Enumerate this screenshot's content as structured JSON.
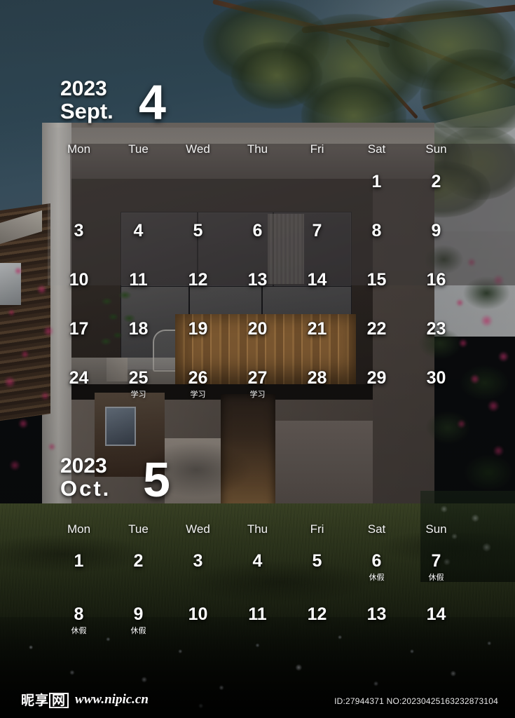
{
  "months": [
    {
      "id": "sept",
      "year": "2023",
      "name": "Sept.",
      "number": "4",
      "weekdays": [
        "Mon",
        "Tue",
        "Wed",
        "Thu",
        "Fri",
        "Sat",
        "Sun"
      ],
      "weeks": [
        [
          {
            "day": "",
            "note": ""
          },
          {
            "day": "",
            "note": ""
          },
          {
            "day": "",
            "note": ""
          },
          {
            "day": "",
            "note": ""
          },
          {
            "day": "",
            "note": ""
          },
          {
            "day": "1",
            "note": ""
          },
          {
            "day": "2",
            "note": ""
          }
        ],
        [
          {
            "day": "3",
            "note": ""
          },
          {
            "day": "4",
            "note": ""
          },
          {
            "day": "5",
            "note": ""
          },
          {
            "day": "6",
            "note": ""
          },
          {
            "day": "7",
            "note": ""
          },
          {
            "day": "8",
            "note": ""
          },
          {
            "day": "9",
            "note": ""
          }
        ],
        [
          {
            "day": "10",
            "note": ""
          },
          {
            "day": "11",
            "note": ""
          },
          {
            "day": "12",
            "note": ""
          },
          {
            "day": "13",
            "note": ""
          },
          {
            "day": "14",
            "note": ""
          },
          {
            "day": "15",
            "note": ""
          },
          {
            "day": "16",
            "note": ""
          }
        ],
        [
          {
            "day": "17",
            "note": ""
          },
          {
            "day": "18",
            "note": ""
          },
          {
            "day": "19",
            "note": ""
          },
          {
            "day": "20",
            "note": ""
          },
          {
            "day": "21",
            "note": ""
          },
          {
            "day": "22",
            "note": ""
          },
          {
            "day": "23",
            "note": ""
          }
        ],
        [
          {
            "day": "24",
            "note": ""
          },
          {
            "day": "25",
            "note": "学习"
          },
          {
            "day": "26",
            "note": "学习"
          },
          {
            "day": "27",
            "note": "学习"
          },
          {
            "day": "28",
            "note": ""
          },
          {
            "day": "29",
            "note": ""
          },
          {
            "day": "30",
            "note": ""
          }
        ]
      ]
    },
    {
      "id": "oct",
      "year": "2023",
      "name": "Oct.",
      "number": "5",
      "weekdays": [
        "Mon",
        "Tue",
        "Wed",
        "Thu",
        "Fri",
        "Sat",
        "Sun"
      ],
      "weeks": [
        [
          {
            "day": "1",
            "note": ""
          },
          {
            "day": "2",
            "note": ""
          },
          {
            "day": "3",
            "note": ""
          },
          {
            "day": "4",
            "note": ""
          },
          {
            "day": "5",
            "note": ""
          },
          {
            "day": "6",
            "note": "休假"
          },
          {
            "day": "7",
            "note": "休假"
          }
        ],
        [
          {
            "day": "8",
            "note": "休假"
          },
          {
            "day": "9",
            "note": "休假"
          },
          {
            "day": "10",
            "note": ""
          },
          {
            "day": "11",
            "note": ""
          },
          {
            "day": "12",
            "note": ""
          },
          {
            "day": "13",
            "note": ""
          },
          {
            "day": "14",
            "note": ""
          }
        ]
      ]
    }
  ],
  "footer": {
    "logo_part1": "昵享",
    "logo_part2": "网",
    "url": "www.nipic.cn",
    "meta": "ID:27944371 NO:20230425163232873104"
  },
  "colors": {
    "text": "#ffffff",
    "sky": "#31495a",
    "wood": "#8a6236",
    "flower_pink": "#c42a68",
    "grass": "#3c4726"
  }
}
